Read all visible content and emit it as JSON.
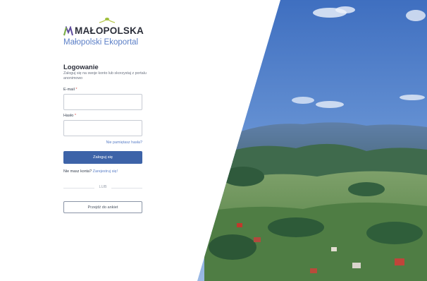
{
  "brand": {
    "name": "MAŁOPOLSKA",
    "subtitle": "Małopolski Ekoportal"
  },
  "login": {
    "title": "Logowanie",
    "description": "Zaloguj się na swoje konto lub skorzystaj z portalu anonimowo",
    "email_label": "E-mail",
    "password_label": "Hasło",
    "required_mark": "*",
    "email_value": "",
    "password_value": "",
    "forgot_link": "Nie pamiętasz hasła?",
    "submit_label": "Zaloguj się",
    "no_account_text": "Nie masz konta?",
    "register_link": "Zarejestruj się!",
    "divider_text": "LUB",
    "survey_button": "Przejdź do ankiet"
  },
  "colors": {
    "primary": "#3d63a8",
    "link": "#5b7fc7",
    "brand_green": "#7bb342",
    "brand_purple": "#5e4b9c"
  },
  "icons": {
    "logo_mark": "malopolska-logo-icon",
    "sprig": "leaf-sprig-icon"
  },
  "photo": {
    "subject": "mountain-landscape-photo"
  }
}
